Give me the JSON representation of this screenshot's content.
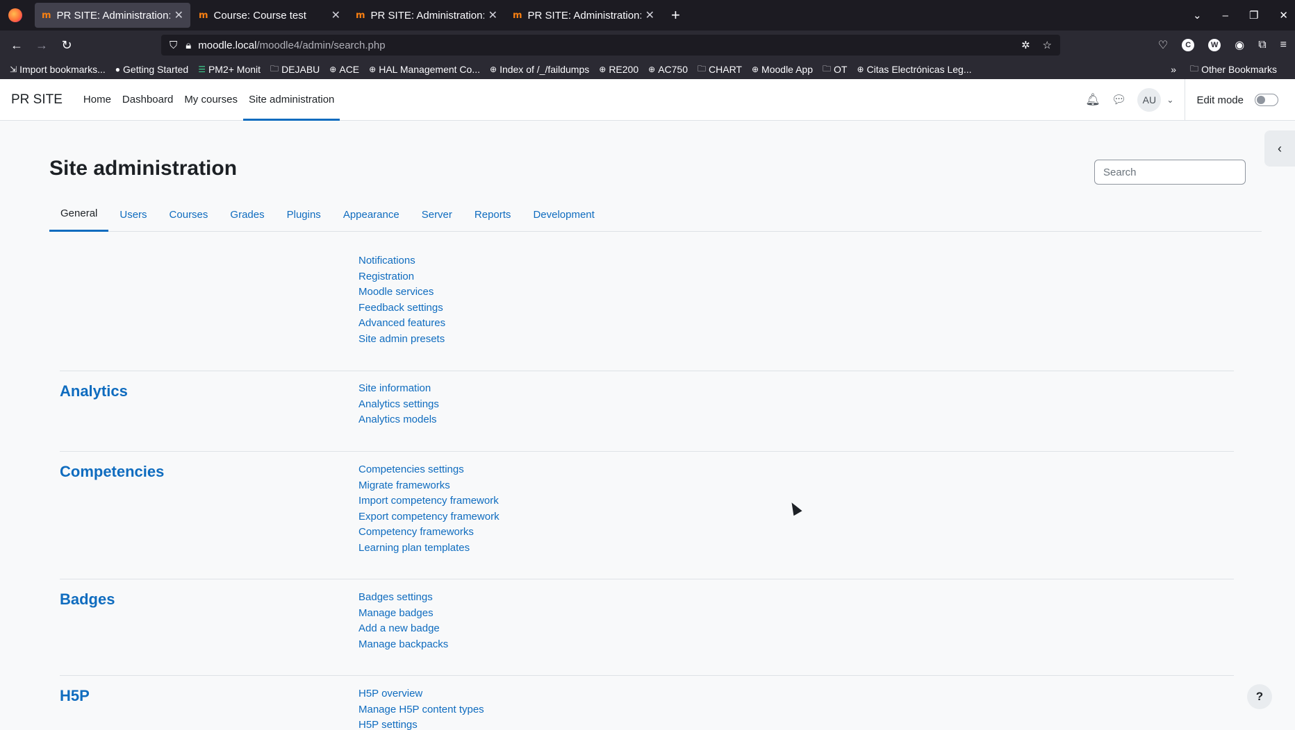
{
  "browser": {
    "tabs": [
      {
        "title": "PR SITE: Administration:",
        "active": true
      },
      {
        "title": "Course: Course test",
        "active": false
      },
      {
        "title": "PR SITE: Administration:",
        "active": false
      },
      {
        "title": "PR SITE: Administration:",
        "active": false
      }
    ],
    "url_host": "moodle.local",
    "url_path": "/moodle4/admin/search.php",
    "bookmarks": [
      "Import bookmarks...",
      "Getting Started",
      "PM2+ Monit",
      "DEJABU",
      "ACE",
      "HAL Management Co...",
      "Index of /_/faildumps",
      "RE200",
      "AC750",
      "CHART",
      "Moodle App",
      "OT",
      "Citas Electrónicas Leg..."
    ],
    "other_bookmarks": "Other Bookmarks"
  },
  "header": {
    "brand": "PR SITE",
    "nav": [
      "Home",
      "Dashboard",
      "My courses",
      "Site administration"
    ],
    "active_nav": "Site administration",
    "avatar_initials": "AU",
    "edit_mode_label": "Edit mode"
  },
  "page": {
    "title": "Site administration",
    "search_placeholder": "Search",
    "tabs": [
      "General",
      "Users",
      "Courses",
      "Grades",
      "Plugins",
      "Appearance",
      "Server",
      "Reports",
      "Development"
    ],
    "active_tab": "General",
    "sections": [
      {
        "title": "",
        "links": [
          "Notifications",
          "Registration",
          "Moodle services",
          "Feedback settings",
          "Advanced features",
          "Site admin presets"
        ]
      },
      {
        "title": "Analytics",
        "links": [
          "Site information",
          "Analytics settings",
          "Analytics models"
        ]
      },
      {
        "title": "Competencies",
        "links": [
          "Competencies settings",
          "Migrate frameworks",
          "Import competency framework",
          "Export competency framework",
          "Competency frameworks",
          "Learning plan templates"
        ]
      },
      {
        "title": "Badges",
        "links": [
          "Badges settings",
          "Manage badges",
          "Add a new badge",
          "Manage backpacks"
        ]
      },
      {
        "title": "H5P",
        "links": [
          "H5P overview",
          "Manage H5P content types",
          "H5P settings"
        ]
      }
    ],
    "help_label": "?"
  },
  "colors": {
    "link": "#0f6cbf",
    "text": "#1d2125",
    "chrome": "#2b2a33"
  }
}
